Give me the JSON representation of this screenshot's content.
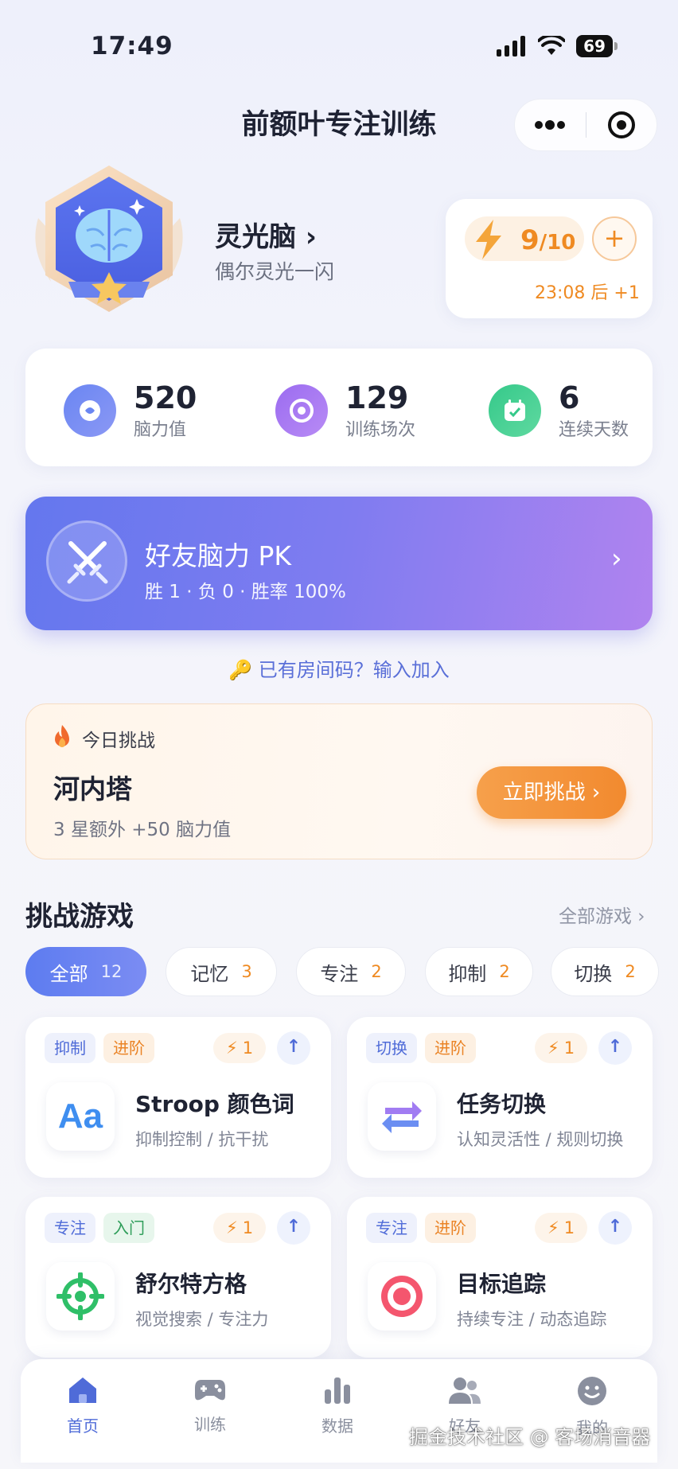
{
  "status": {
    "time": "17:49",
    "battery": "69"
  },
  "header": {
    "title": "前额叶专注训练"
  },
  "profile": {
    "name": "灵光脑",
    "subtitle": "偶尔灵光一闪"
  },
  "energy": {
    "value": "9",
    "max": "/10",
    "plus": "+",
    "refill": "23:08 后 +1"
  },
  "stats": [
    {
      "value": "520",
      "label": "脑力值"
    },
    {
      "value": "129",
      "label": "训练场次"
    },
    {
      "value": "6",
      "label": "连续天数"
    }
  ],
  "pk": {
    "title": "好友脑力 PK",
    "subtitle": "胜 1 · 负 0 · 胜率 100%"
  },
  "join": {
    "text": "已有房间码？输入加入"
  },
  "challenge": {
    "tag": "今日挑战",
    "title": "河内塔",
    "subtitle": "3 星额外 +50 脑力值",
    "button": "立即挑战 ›"
  },
  "games_section": {
    "title": "挑战游戏",
    "more": "全部游戏 ›"
  },
  "filters": [
    {
      "label": "全部",
      "count": "12"
    },
    {
      "label": "记忆",
      "count": "3"
    },
    {
      "label": "专注",
      "count": "2"
    },
    {
      "label": "抑制",
      "count": "2"
    },
    {
      "label": "切换",
      "count": "2"
    }
  ],
  "games": [
    {
      "tag1": "抑制",
      "tag2": "进阶",
      "cost": "1",
      "name": "Stroop 颜色词",
      "desc": "抑制控制 / 抗干扰",
      "icon": "Aa"
    },
    {
      "tag1": "切换",
      "tag2": "进阶",
      "cost": "1",
      "name": "任务切换",
      "desc": "认知灵活性 / 规则切换",
      "icon": "swap-icon"
    },
    {
      "tag1": "专注",
      "tag2": "入门",
      "cost": "1",
      "name": "舒尔特方格",
      "desc": "视觉搜索 / 专注力",
      "icon": "crosshair-icon"
    },
    {
      "tag1": "专注",
      "tag2": "进阶",
      "cost": "1",
      "name": "目标追踪",
      "desc": "持续专注 / 动态追踪",
      "icon": "target-icon"
    }
  ],
  "tabs": [
    {
      "label": "首页"
    },
    {
      "label": "训练"
    },
    {
      "label": "数据"
    },
    {
      "label": "好友"
    },
    {
      "label": "我的"
    }
  ],
  "watermark": "掘金技术社区 @ 客场消音器",
  "colors": {
    "accent": "#4f6bd8",
    "orange": "#ef8a22",
    "pk_start": "#6477ee",
    "pk_end": "#b083ef"
  }
}
